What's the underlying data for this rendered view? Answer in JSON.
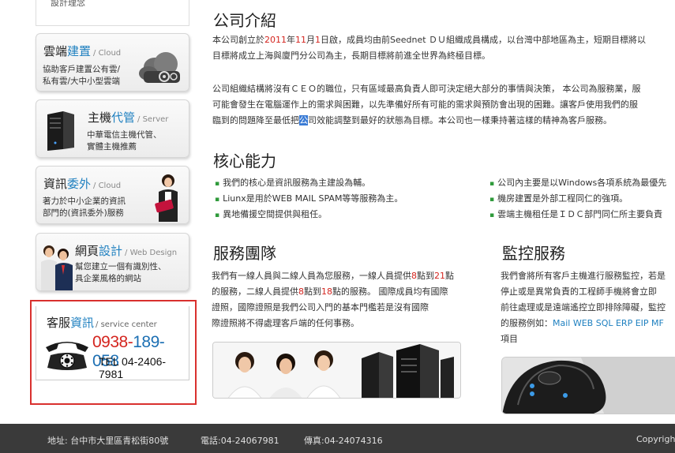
{
  "sidebar": {
    "top_item": "設計理念",
    "cards": [
      {
        "title_a": "雲端",
        "title_b": "建置",
        "title_en": "/ Cloud",
        "desc1": "協助客戶建置公有雲/",
        "desc2": "私有雲/大中小型雲端"
      },
      {
        "title_a": "主機",
        "title_b": "代管",
        "title_en": "/ Server",
        "desc1": "中華電信主機代管、",
        "desc2": "實體主機推薦"
      },
      {
        "title_a": "資訊",
        "title_b": "委外",
        "title_en": "/ Cloud",
        "desc1": "著力於中小企業的資訊",
        "desc2": "部門的(資訊委外)服務"
      },
      {
        "title_a": "網頁",
        "title_b": "設計",
        "title_en": "/ Web Design",
        "desc1": "幫您建立一個有識別性、",
        "desc2": "具企業風格的網站"
      }
    ],
    "service": {
      "title_a": "客服",
      "title_b": "資訊",
      "title_en": "/ service center",
      "phone_a": "0938-",
      "phone_b": "189-058",
      "tel": "TEL 04-2406-7981"
    }
  },
  "about": {
    "heading": "公司介紹",
    "p1_l1_a": "本公司創立於",
    "p1_l1_y": "2011",
    "p1_l1_b": "年",
    "p1_l1_m": "11",
    "p1_l1_c": "月",
    "p1_l1_d": "1",
    "p1_l1_e": "日啟，成員均由前Seednet ＤＵ組織成員構成，以台灣中部地區為主，短期目標將以",
    "p1_l2": "目標將成立上海與廈門分公司為主，長期目標將前進全世界為終極目標。",
    "p2_l1": "公司組織結構將沒有ＣＥＯ的職位，只有區域最高負責人即可決定絕大部分的事情與決策， 本公司為服務業，服",
    "p2_l2": "可能會發生在電腦運作上的需求與困難，以先準備好所有可能的需求與預防會出現的困難。讓客戶使用我們的服",
    "p2_l3_a": "臨到的問題降至最低把",
    "p2_l3_sel": "公",
    "p2_l3_b": "司效能調整到最好的狀態為目標。本公司也一樣秉持著這樣的精神為客戶服務。"
  },
  "core": {
    "heading": "核心能力",
    "left": [
      "我們的核心是資訊服務為主建設為輔。",
      "Liunx是用於WEB MAIL SPAM等等服務為主。",
      "異地備援空間提供與租任。"
    ],
    "right": [
      "公司內主要是以Windows各項系統為最優先",
      "機房建置是外部工程同仁的強項。",
      "雲端主機租任是ＩＤＣ部門同仁所主要負責"
    ]
  },
  "team": {
    "heading": "服務團隊",
    "l1_a": "我們有一線人員與二線人員為您服務，一線人員提供",
    "l1_n1": "8",
    "l1_b": "點到",
    "l1_n2": "21",
    "l1_c": "點",
    "l2_a": "的服務，二線人員提供",
    "l2_n1": "8",
    "l2_b": "點到",
    "l2_n2": "18",
    "l2_c": "點的服務。 國際成員均有國際",
    "l3": "證照，國際證照是我們公司入門的基本門檻若是沒有國際",
    "l4": "際證照將不得處理客戶端的任何事務。"
  },
  "monitor": {
    "heading": "監控服務",
    "l1": "我們會將所有客戶主機進行服務監控，若是",
    "l2": "停止或是異常負責的工程師手機將會立即",
    "l3": "前往處理或是遠端遙控立即排除障礙，監控",
    "l4_a": "的服務例如：",
    "l4_b": "Mail WEB SQL ERP EIP MF",
    "l5": "項目"
  },
  "footer": {
    "address": "地址: 台中市大里區青松街80號",
    "phone": "電話:04-24067981",
    "fax": "傳真:04-24074316",
    "copyright": "Copyrigh"
  },
  "colors": {
    "accent_blue": "#1f80c0",
    "accent_red": "#d4251f",
    "bullet_green": "#2f9a3b",
    "footer_bg": "#3a3a3a"
  }
}
